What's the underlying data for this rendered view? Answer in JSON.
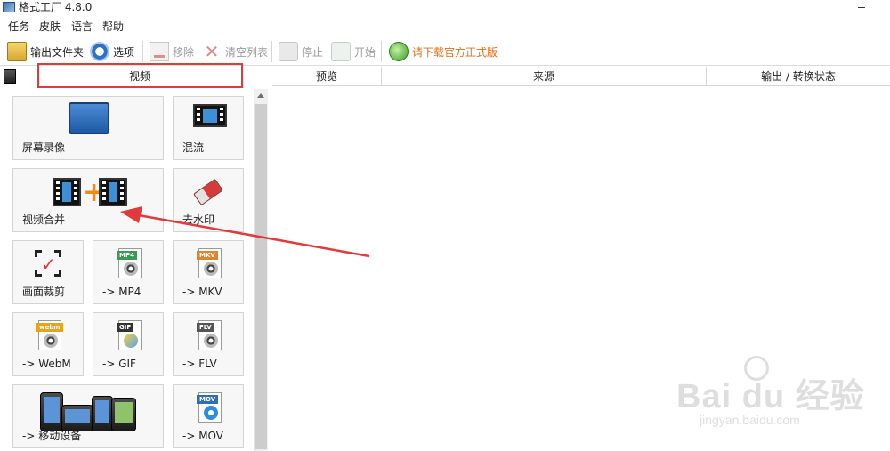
{
  "window": {
    "title": "格式工厂 4.8.0"
  },
  "menu": [
    "任务",
    "皮肤",
    "语言",
    "帮助"
  ],
  "toolbar": {
    "output_folder": "输出文件夹",
    "options": "选项",
    "remove": "移除",
    "clear_list": "清空列表",
    "stop": "停止",
    "start": "开始",
    "download": "请下载官方正式版"
  },
  "category": {
    "label": "视频"
  },
  "tools": {
    "screen_record": "屏幕录像",
    "mux": "混流",
    "video_merge": "视频合并",
    "remove_watermark": "去水印",
    "crop": "画面裁剪",
    "to_mp4": "-> MP4",
    "to_mkv": "-> MKV",
    "to_webm": "-> WebM",
    "to_gif": "-> GIF",
    "to_flv": "-> FLV",
    "mobile": "-> 移动设备",
    "to_mov": "-> MOV"
  },
  "badges": {
    "mp4": "MP4",
    "mkv": "MKV",
    "webm": "webm",
    "gif": "GIF",
    "flv": "FLV",
    "mov": "MOV"
  },
  "table": {
    "headers": [
      "预览",
      "来源",
      "输出 / 转换状态"
    ]
  },
  "watermark": {
    "main": "Bai du 经验",
    "sub": "jingyan.baidu.com"
  },
  "colors": {
    "highlight": "#e03a3a",
    "download_link": "#e0701c"
  }
}
